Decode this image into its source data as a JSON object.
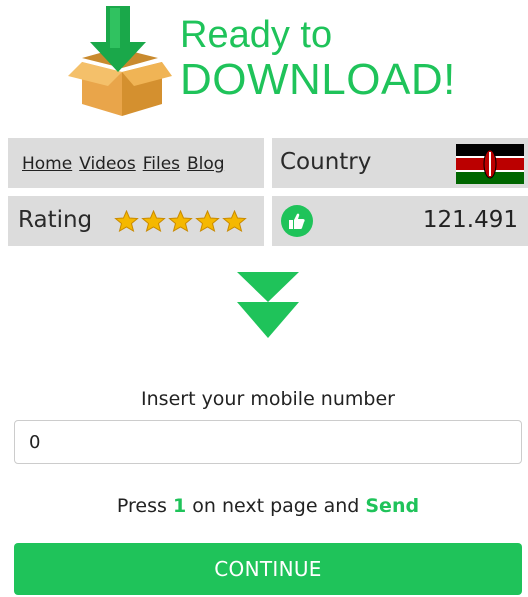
{
  "header": {
    "title_line1": "Ready to",
    "title_line2": "DOWNLOAD!",
    "icon": "download-box-icon"
  },
  "nav": {
    "items": [
      {
        "label": "Home"
      },
      {
        "label": "Videos"
      },
      {
        "label": "Files"
      },
      {
        "label": "Blog"
      }
    ]
  },
  "country": {
    "label": "Country",
    "flag": "kenya-flag"
  },
  "rating": {
    "label": "Rating",
    "stars": 5,
    "max_stars": 5
  },
  "likes": {
    "icon": "thumbs-up-icon",
    "count": "121.491"
  },
  "form": {
    "prompt": "Insert your mobile number",
    "phone_value": "0",
    "hint_before": "Press",
    "hint_key": "1",
    "hint_middle": "on next page and",
    "hint_action": "Send",
    "continue_label": "CONTINUE"
  },
  "colors": {
    "accent": "#1fc35a",
    "cell_bg": "#dcdcdc",
    "star": "#f5b800"
  }
}
